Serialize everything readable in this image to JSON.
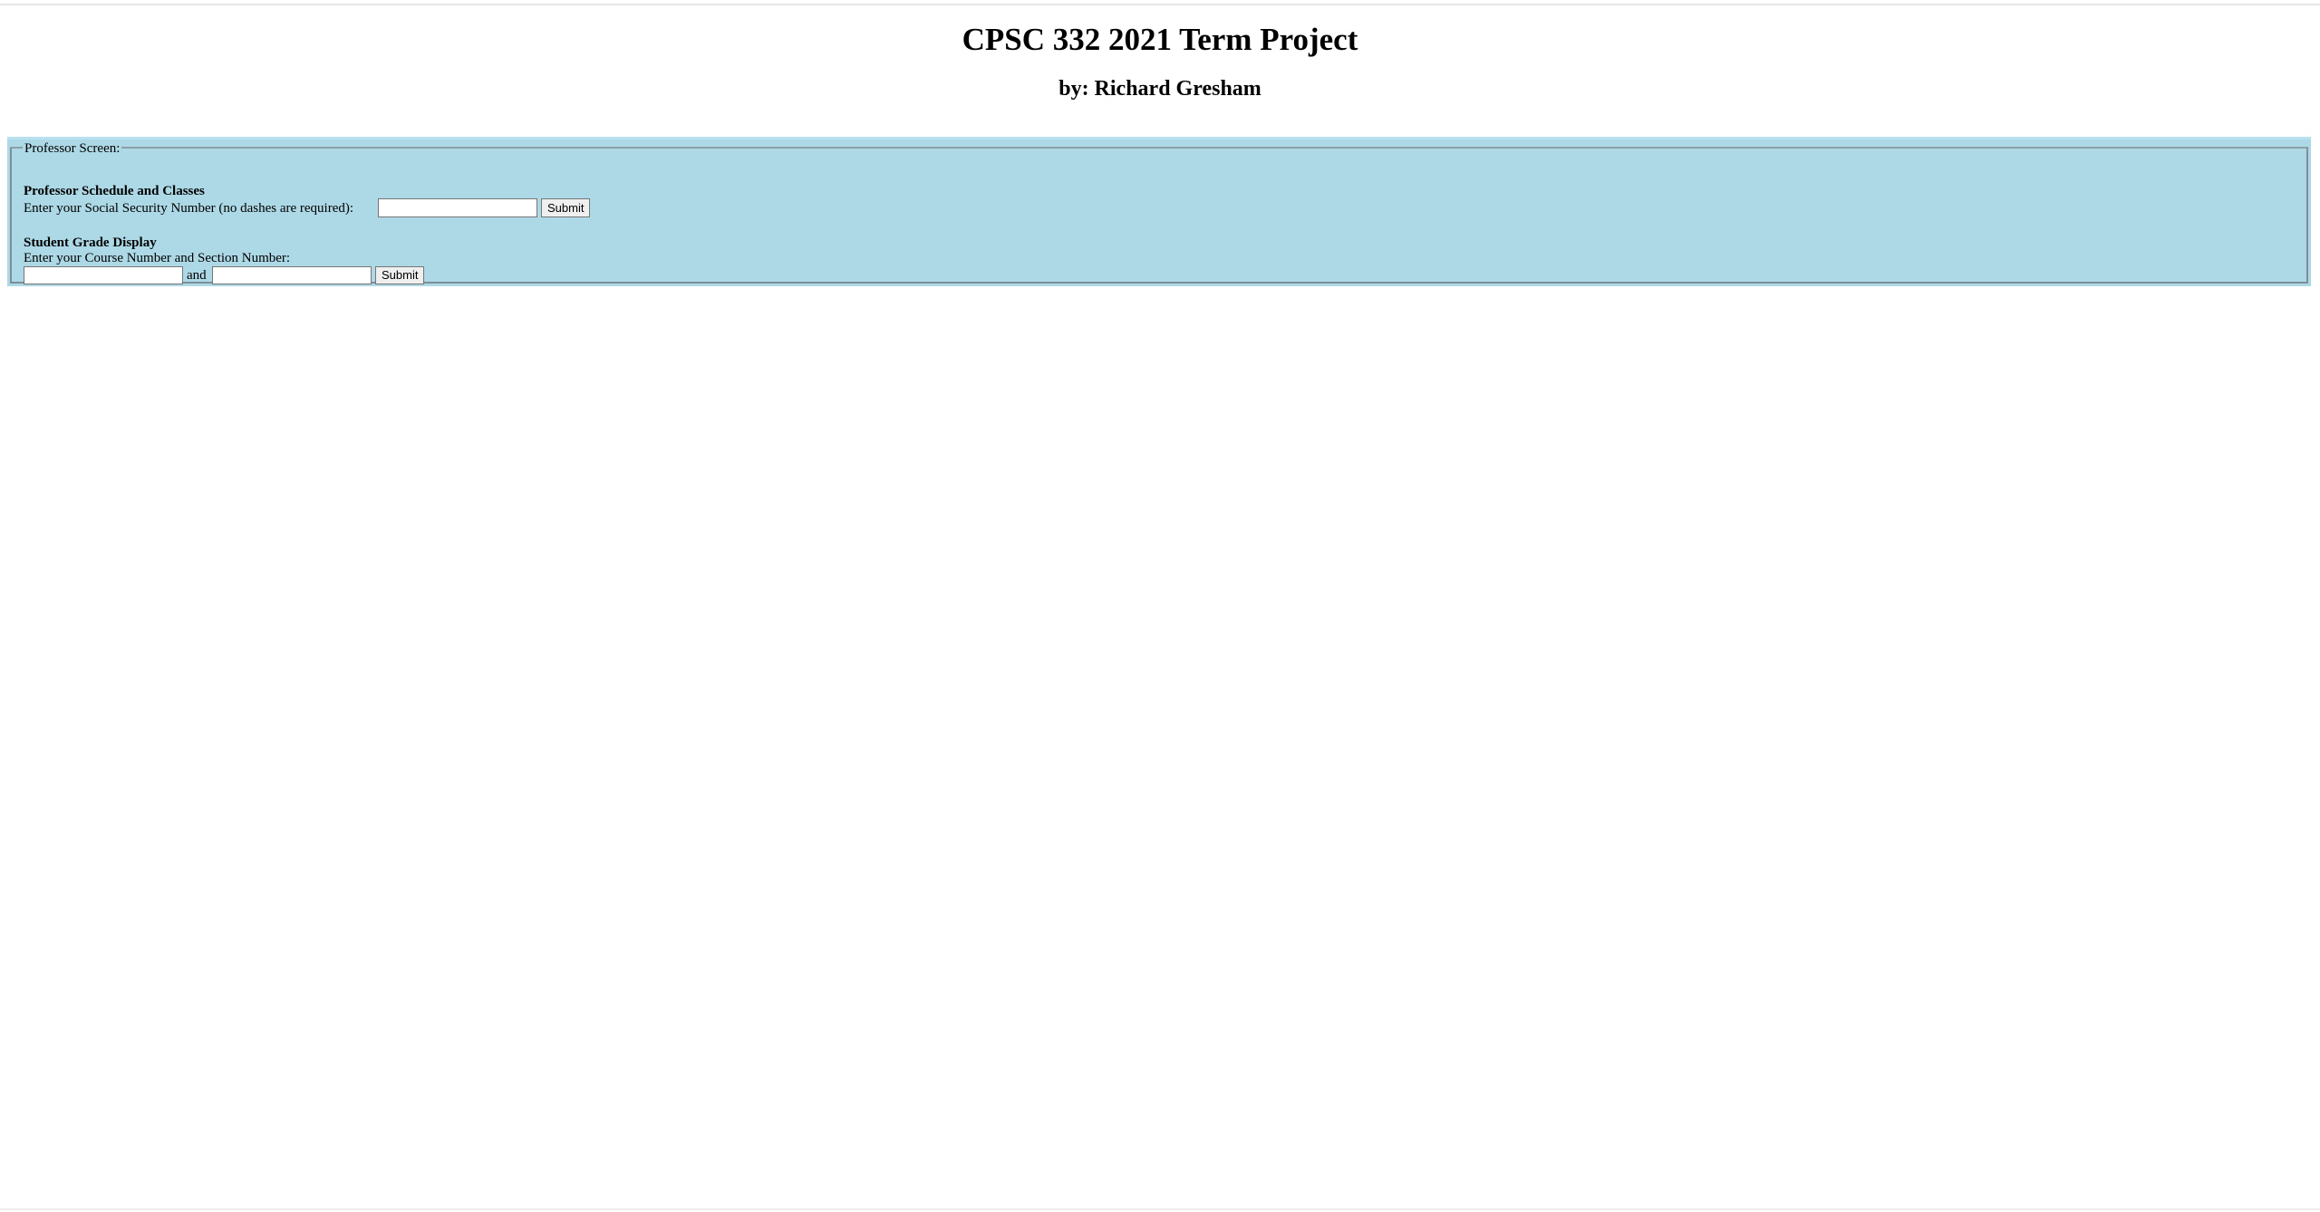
{
  "header": {
    "title": "CPSC 332 2021 Term Project",
    "subtitle": "by: Richard Gresham"
  },
  "professor_screen": {
    "legend": "Professor Screen:",
    "schedule_section": {
      "heading": "Professor Schedule and Classes",
      "prompt": "Enter your Social Security Number (no dashes are required):",
      "ssn_value": "",
      "submit_label": "Submit"
    },
    "grade_section": {
      "heading": "Student Grade Display",
      "prompt": "Enter your Course Number and Section Number:",
      "course_value": "",
      "joiner": "and",
      "section_value": "",
      "submit_label": "Submit"
    }
  },
  "colors": {
    "panel_background": "#add8e6",
    "page_background": "#ffffff"
  }
}
